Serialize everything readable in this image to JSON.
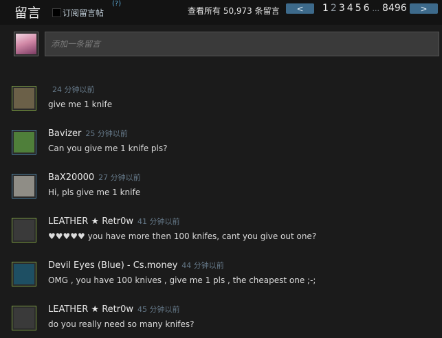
{
  "header": {
    "title": "留言",
    "subscribe_label": "订阅留言帖",
    "help": "(?)",
    "count_text": "查看所有 50,973 条留言",
    "prev_label": "<",
    "next_label": ">",
    "pages": [
      "1",
      "2",
      "3",
      "4",
      "5",
      "6"
    ],
    "ellipsis": "...",
    "last_page": "8496",
    "current_page": "2"
  },
  "compose": {
    "placeholder": "添加一条留言"
  },
  "comments": [
    {
      "author": "",
      "time": "24 分钟以前",
      "text": "give me 1 knife",
      "avatar_color": "#6b6048",
      "border": "#7c9c43"
    },
    {
      "author": "Bavizer",
      "time": "25 分钟以前",
      "text": "Can you give me 1 knife pls?",
      "avatar_color": "#4f7f3a",
      "border": "#4a7a99"
    },
    {
      "author": "BaX20000",
      "time": "27 分钟以前",
      "text": "Hi, pls give me 1 knife",
      "avatar_color": "#8f8d86",
      "border": "#4a7a99"
    },
    {
      "author": "LEATHER ★ Retr0w",
      "time": "41 分钟以前",
      "text": "♥♥♥♥♥ you have more then 100 knifes, cant you give out one?",
      "avatar_color": "#3a3a3a",
      "border": "#7c9c43"
    },
    {
      "author": "Devil Eyes (Blue) - Cs.money",
      "time": "44 分钟以前",
      "text": "OMG , you have 100 knives , give me 1 pls , the cheapest one ;-;",
      "avatar_color": "#1e4f63",
      "border": "#7c9c43"
    },
    {
      "author": "LEATHER ★ Retr0w",
      "time": "45 分钟以前",
      "text": "do you really need so many knifes?",
      "avatar_color": "#3a3a3a",
      "border": "#7c9c43"
    }
  ]
}
